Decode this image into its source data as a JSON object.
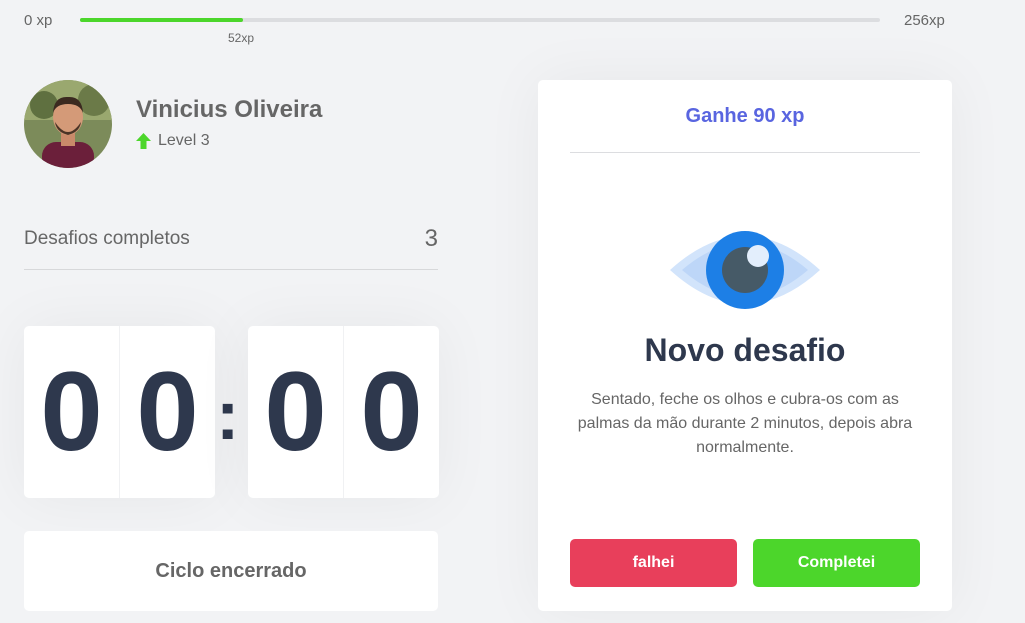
{
  "xp": {
    "min_label": "0 xp",
    "max_label": "256xp",
    "current_label": "52xp",
    "current": 52,
    "max": 256
  },
  "profile": {
    "name": "Vinicius Oliveira",
    "level_label": "Level 3",
    "level_icon": "arrow-up-icon"
  },
  "challenges_completed": {
    "label": "Desafios completos",
    "value": "3"
  },
  "countdown": {
    "minute_left": "0",
    "minute_right": "0",
    "separator": ":",
    "second_left": "0",
    "second_right": "0"
  },
  "cycle_button": {
    "label": "Ciclo encerrado"
  },
  "challenge_card": {
    "header": "Ganhe 90 xp",
    "icon": "eye-icon",
    "title": "Novo desafio",
    "description": "Sentado, feche os olhos e cubra-os com as palmas da mão durante 2 minutos, depois abra normalmente.",
    "fail_label": "falhei",
    "complete_label": "Completei"
  },
  "colors": {
    "accent": "#5965e0",
    "success": "#4cd62b",
    "danger": "#e83f5b",
    "text_dark": "#2e384d",
    "text": "#666666",
    "background": "#f2f3f5"
  }
}
